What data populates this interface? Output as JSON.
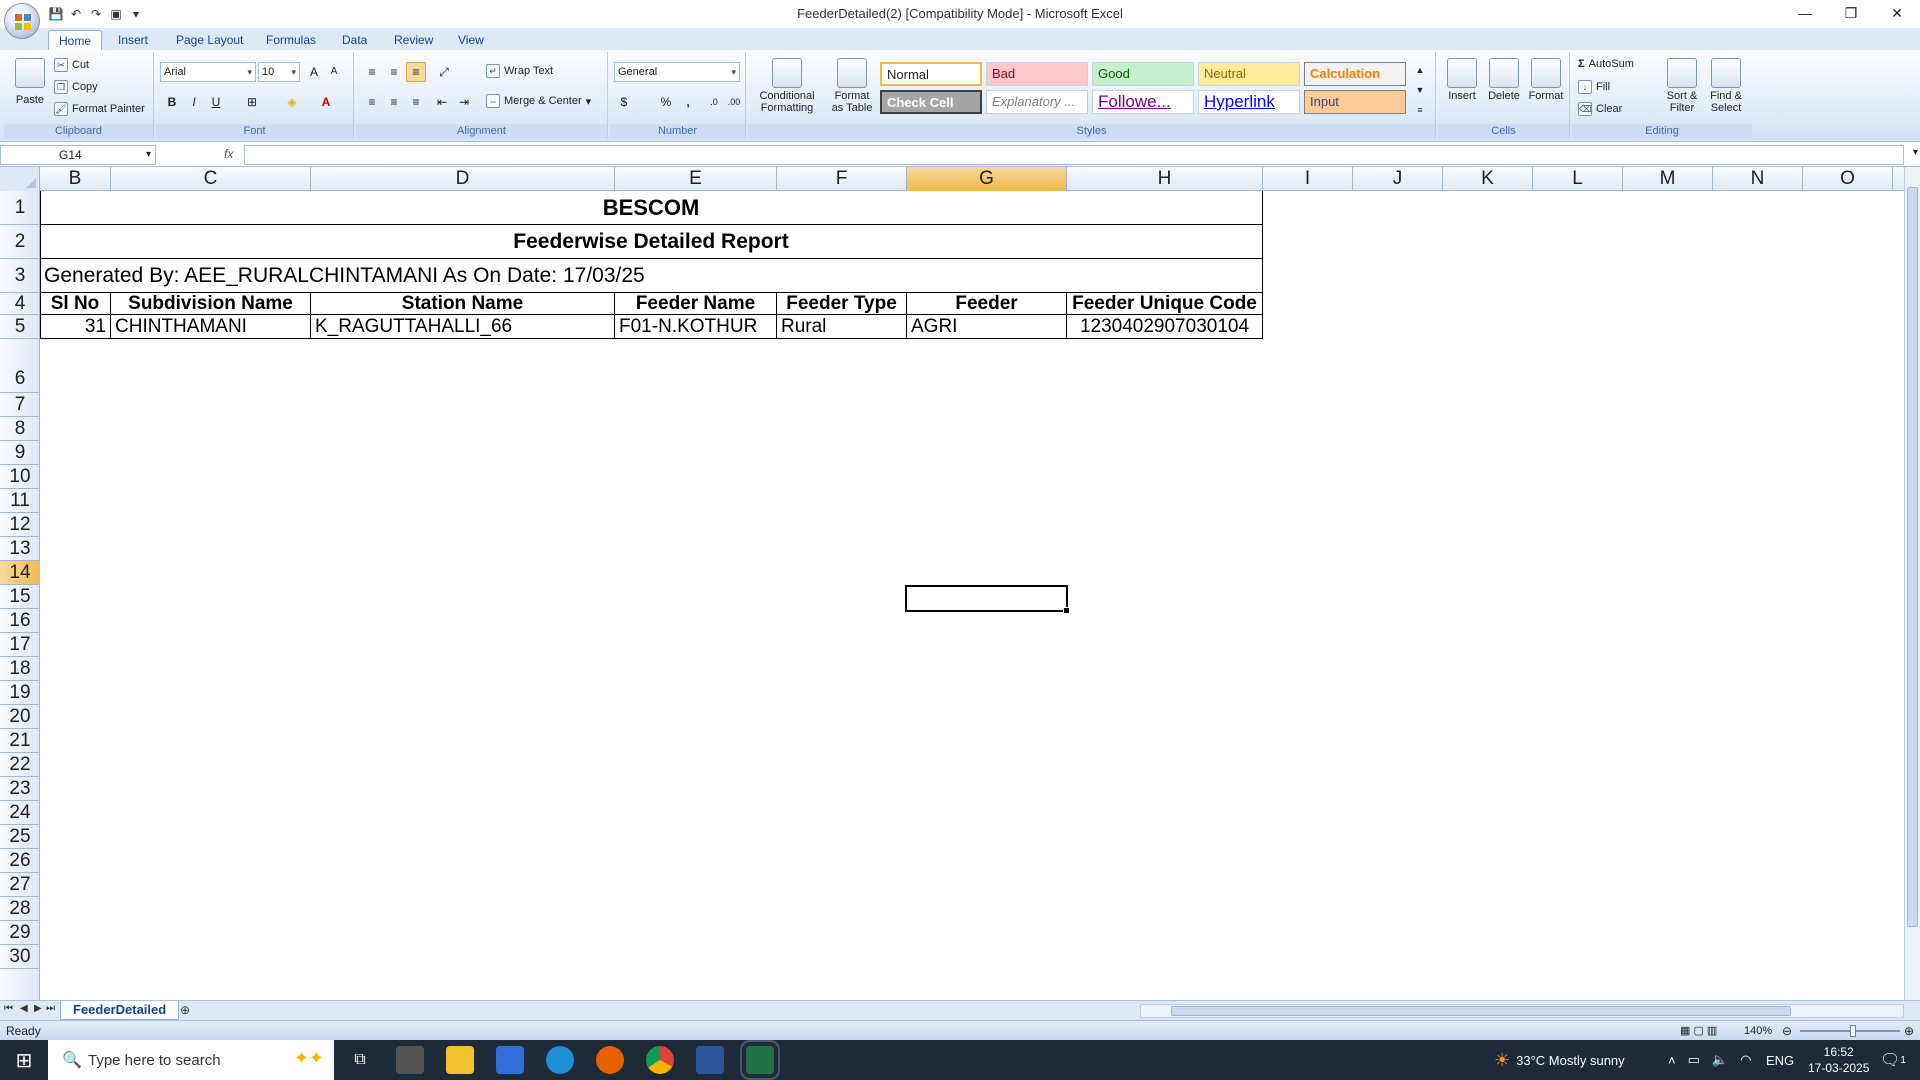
{
  "window": {
    "title": "FeederDetailed(2)  [Compatibility Mode] - Microsoft Excel",
    "controls": [
      "minimize",
      "restore",
      "close"
    ]
  },
  "tabs": [
    "Home",
    "Insert",
    "Page Layout",
    "Formulas",
    "Data",
    "Review",
    "View"
  ],
  "active_tab": "Home",
  "ribbon": {
    "clipboard": {
      "paste": "Paste",
      "cut": "Cut",
      "copy": "Copy",
      "format_painter": "Format Painter",
      "label": "Clipboard"
    },
    "font": {
      "name": "Arial",
      "size": "10",
      "label": "Font",
      "bold": "B",
      "italic": "I",
      "underline": "U"
    },
    "alignment": {
      "wrap": "Wrap Text",
      "merge": "Merge & Center",
      "label": "Alignment"
    },
    "number": {
      "format": "General",
      "label": "Number",
      "percent": "%",
      "comma": ","
    },
    "styles": {
      "cond": "Conditional Formatting",
      "cond_l1": "Conditional",
      "cond_l2": "Formatting",
      "table": "Format as Table",
      "table_l1": "Format",
      "table_l2": "as Table",
      "label": "Styles",
      "cells": [
        {
          "text": "Normal"
        },
        {
          "text": "Bad"
        },
        {
          "text": "Good"
        },
        {
          "text": "Neutral"
        },
        {
          "text": "Calculation"
        },
        {
          "text": "Check Cell"
        },
        {
          "text": "Explanatory ..."
        },
        {
          "text": "Followe..."
        },
        {
          "text": "Hyperlink"
        },
        {
          "text": "Input"
        }
      ]
    },
    "cells": {
      "insert": "Insert",
      "delete": "Delete",
      "format": "Format",
      "label": "Cells"
    },
    "editing": {
      "autosum": "AutoSum",
      "fill": "Fill",
      "clear": "Clear",
      "sort": "Sort & Filter",
      "sort_l1": "Sort &",
      "sort_l2": "Filter",
      "find": "Find & Select",
      "find_l1": "Find &",
      "find_l2": "Select",
      "label": "Editing"
    }
  },
  "formula_bar": {
    "name_box": "G14",
    "fx": "fx",
    "value": ""
  },
  "columns": [
    "B",
    "C",
    "D",
    "E",
    "F",
    "G",
    "H",
    "I",
    "J",
    "K",
    "L",
    "M",
    "N",
    "O"
  ],
  "rows": [
    "1",
    "2",
    "3",
    "4",
    "5",
    "6",
    "7",
    "8",
    "9",
    "10",
    "11",
    "12",
    "13",
    "14",
    "15",
    "16",
    "17",
    "18",
    "19",
    "20",
    "21",
    "22",
    "23",
    "24",
    "25",
    "26",
    "27",
    "28",
    "29",
    "30"
  ],
  "selected": {
    "column": "G",
    "row": "14"
  },
  "report": {
    "title": "BESCOM",
    "subtitle": "Feederwise   Detailed  Report",
    "generated": "Generated  By:  AEE_RURALCHINTAMANI    As On Date: 17/03/25",
    "headers": [
      "Sl  No",
      "Subdivision Name",
      "Station Name",
      "Feeder  Name",
      "Feeder  Type",
      "Feeder",
      "Feeder Unique Code"
    ],
    "rows": [
      [
        "31",
        "CHINTHAMANI",
        "K_RAGUTTAHALLI_66",
        "F01-N.KOTHUR",
        "Rural",
        "AGRI",
        "1230402907030104"
      ]
    ]
  },
  "sheet_tab": "FeederDetailed",
  "status": {
    "ready": "Ready",
    "zoom": "140%"
  },
  "taskbar": {
    "search_placeholder": "Type here to search",
    "weather": "33°C  Mostly sunny",
    "lang": "ENG",
    "time": "16:52",
    "date": "17-03-2025",
    "notifications": "1"
  },
  "colors": {
    "accent": "#15428b",
    "ribbon_bg": "#dde9f7",
    "selection": "#f1b84d"
  }
}
